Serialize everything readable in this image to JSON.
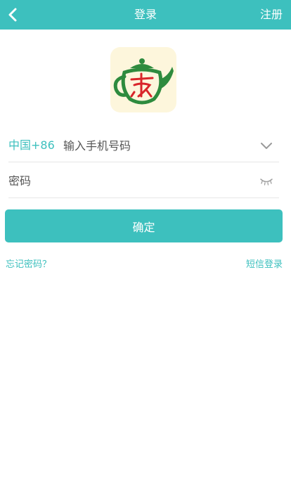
{
  "colors": {
    "accent": "#3dc0be",
    "logo_background": "#fdf6dc"
  },
  "header": {
    "back_icon": "chevron-left-icon",
    "title": "登录",
    "register_label": "注册"
  },
  "logo": {
    "icon": "teapot-logo-icon"
  },
  "phone": {
    "country_code": "中国+86",
    "placeholder": "输入手机号码",
    "dropdown_icon": "chevron-down-icon"
  },
  "password": {
    "placeholder": "密码",
    "visibility_icon": "eye-closed-icon"
  },
  "confirm_label": "确定",
  "links": {
    "forgot_password": "忘记密码？",
    "sms_login": "短信登录"
  }
}
